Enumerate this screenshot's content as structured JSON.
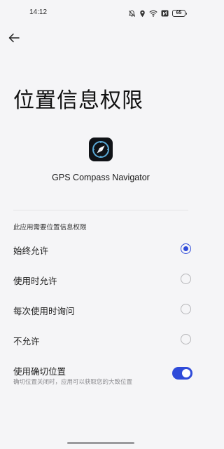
{
  "status_bar": {
    "time": "14:12",
    "battery": "65",
    "icons": [
      "mute-bell-icon",
      "location-icon",
      "wifi-icon",
      "nfc-icon",
      "battery-icon"
    ]
  },
  "header": {
    "back_icon": "back-arrow-icon",
    "title": "位置信息权限"
  },
  "app": {
    "icon": "compass-navigation-icon",
    "name": "GPS Compass Navigator"
  },
  "permission": {
    "section_title": "此应用需要位置信息权限",
    "options": [
      {
        "label": "始终允许",
        "selected": true
      },
      {
        "label": "使用时允许",
        "selected": false
      },
      {
        "label": "每次使用时询问",
        "selected": false
      },
      {
        "label": "不允许",
        "selected": false
      }
    ]
  },
  "precise_location": {
    "label": "使用确切位置",
    "description": "确切位置关闭时，应用可以获取您的大致位置",
    "enabled": true
  },
  "colors": {
    "accent": "#2f4bd9",
    "background": "#f5f5f7"
  }
}
